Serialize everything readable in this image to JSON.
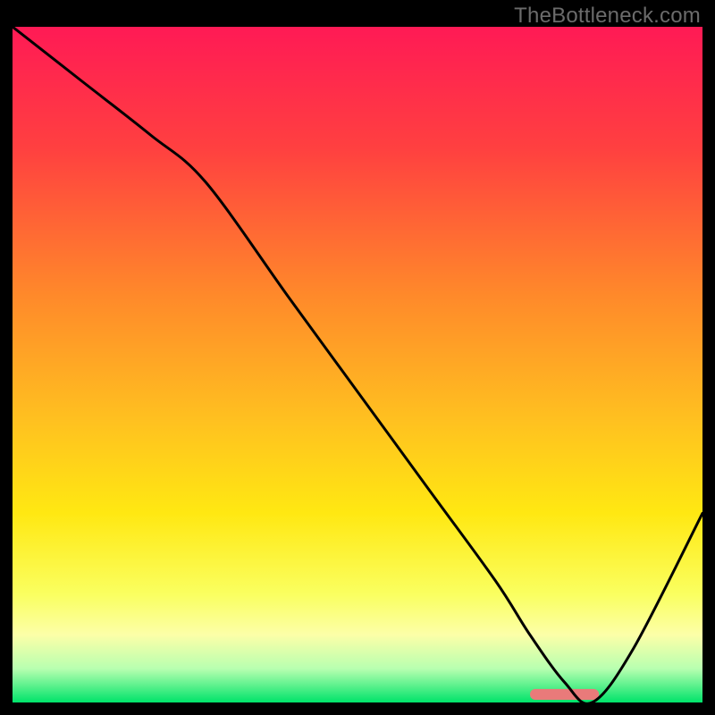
{
  "watermark": "TheBottleneck.com",
  "chart_data": {
    "type": "line",
    "title": "",
    "xlabel": "",
    "ylabel": "",
    "xlim": [
      0,
      100
    ],
    "ylim": [
      0,
      100
    ],
    "grid": false,
    "legend": false,
    "gradient_stops": [
      {
        "pct": 0,
        "color": "#ff1a55"
      },
      {
        "pct": 18,
        "color": "#ff4040"
      },
      {
        "pct": 40,
        "color": "#ff8a2a"
      },
      {
        "pct": 58,
        "color": "#ffc020"
      },
      {
        "pct": 72,
        "color": "#ffe812"
      },
      {
        "pct": 84,
        "color": "#faff60"
      },
      {
        "pct": 90,
        "color": "#fcffa8"
      },
      {
        "pct": 95,
        "color": "#b8ffb0"
      },
      {
        "pct": 100,
        "color": "#00e36a"
      }
    ],
    "curve": {
      "x": [
        0,
        10,
        20,
        28,
        40,
        50,
        60,
        70,
        75,
        80,
        84,
        90,
        100
      ],
      "y": [
        100,
        92,
        84,
        77,
        60,
        46,
        32,
        18,
        10,
        3,
        0,
        8,
        28
      ]
    },
    "highlight_segment": {
      "x_start": 75,
      "x_end": 85,
      "y": 1.2,
      "color": "#e97a7a",
      "thickness_pct": 1.6
    }
  }
}
